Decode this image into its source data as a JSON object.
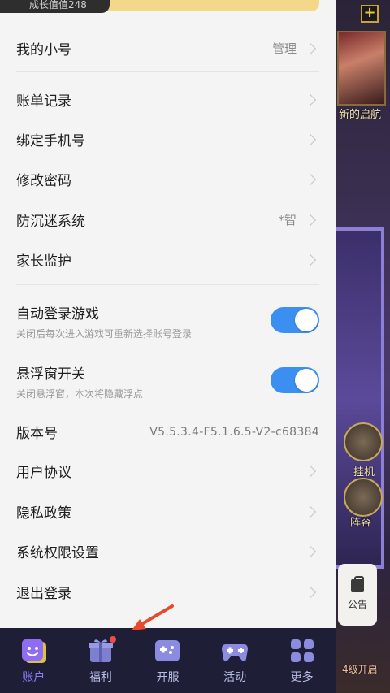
{
  "header": {
    "growth_text": "成长值值248"
  },
  "menu": {
    "alt_account": {
      "label": "我的小号",
      "value": "管理"
    },
    "billing": {
      "label": "账单记录"
    },
    "bind_phone": {
      "label": "绑定手机号"
    },
    "change_password": {
      "label": "修改密码"
    },
    "anti_addiction": {
      "label": "防沉迷系统",
      "value": "*智"
    },
    "parental": {
      "label": "家长监护"
    },
    "auto_login": {
      "label": "自动登录游戏",
      "sub": "关闭后每次进入游戏可重新选择账号登录",
      "on": true
    },
    "float_window": {
      "label": "悬浮窗开关",
      "sub": "关闭悬浮窗，本次将隐藏浮点",
      "on": true
    },
    "version": {
      "label": "版本号",
      "value": "V5.5.3.4-F5.1.6.5-V2-c68384"
    },
    "user_agreement": {
      "label": "用户协议"
    },
    "privacy": {
      "label": "隐私政策"
    },
    "permissions": {
      "label": "系统权限设置"
    },
    "logout": {
      "label": "退出登录"
    }
  },
  "game": {
    "label_sail": "新的启航",
    "label_idle": "挂机",
    "label_lineup": "阵容",
    "label_unlock": "4级开启",
    "notice_label": "公告"
  },
  "bottom_nav": [
    {
      "label": "账户",
      "icon": "account-icon",
      "active": true
    },
    {
      "label": "福利",
      "icon": "gift-icon",
      "badge": true
    },
    {
      "label": "开服",
      "icon": "server-icon"
    },
    {
      "label": "活动",
      "icon": "gamepad-icon"
    },
    {
      "label": "更多",
      "icon": "grid-icon"
    }
  ],
  "colors": {
    "toggle_on": "#3b8ff0",
    "nav_bg": "#1e1f36",
    "nav_active": "#8b7cf6",
    "badge": "#f04a4a",
    "arrow": "#e84b2b"
  }
}
